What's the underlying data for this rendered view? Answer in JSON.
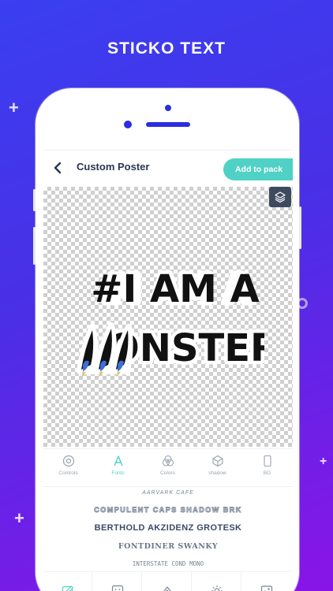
{
  "banner": {
    "title": "STICKO TEXT"
  },
  "header": {
    "title": "Custom Poster",
    "add_button": "Add to pack"
  },
  "sticker": {
    "line1": "#I AM A",
    "line2": "ONSTER"
  },
  "tools": [
    {
      "label": "Controls",
      "icon": "controls-icon"
    },
    {
      "label": "Fonts",
      "icon": "fonts-icon",
      "active": true
    },
    {
      "label": "Colors",
      "icon": "colors-icon"
    },
    {
      "label": "shadow",
      "icon": "shadow-icon"
    },
    {
      "label": "BG",
      "icon": "bg-icon"
    }
  ],
  "fonts": [
    "AARVARK CAFE",
    "COMPULENT CAPS SHADOW BRK",
    "BERTHOLD AKZIDENZ GROTESK",
    "FONTDINER SWANKY",
    "INTERSTATE COND MONO"
  ],
  "bottom_icons": [
    "edit-icon",
    "sticker-icon",
    "effects-icon",
    "brightness-icon",
    "image-icon"
  ],
  "colors": {
    "accent": "#4fd1c5",
    "brand": "#2b2ee0",
    "layers_btn": "#3e4a5e"
  }
}
